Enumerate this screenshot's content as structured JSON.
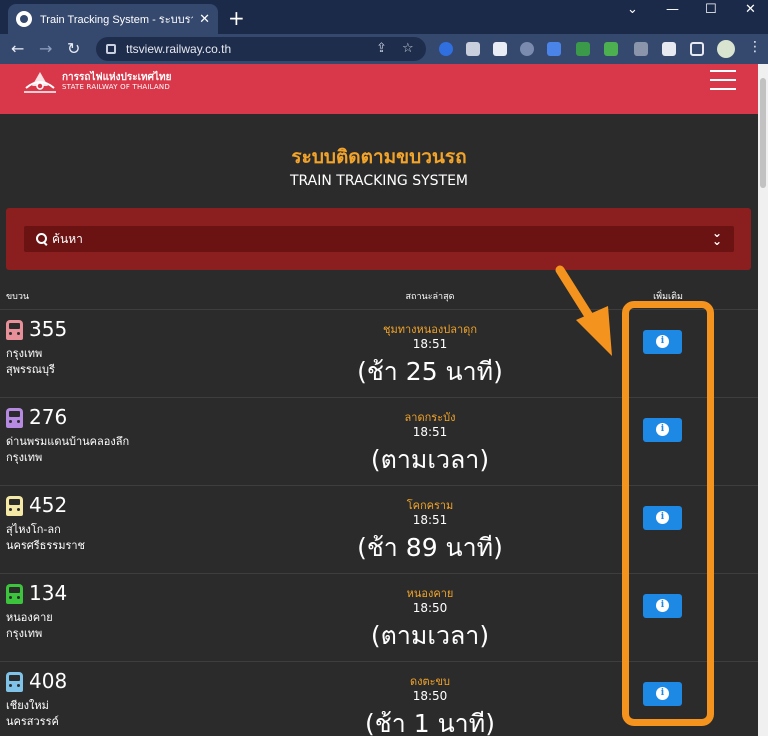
{
  "browser": {
    "tab_title": "Train Tracking System - ระบบรายงาน",
    "tab_close": "✕",
    "new_tab": "+",
    "url": "ttsview.railway.co.th",
    "window_controls": [
      "⌄",
      "—",
      "☐",
      "✕"
    ]
  },
  "site": {
    "logo_th": "การรถไฟแห่งประเทศไทย",
    "logo_en": "STATE RAILWAY OF THAILAND"
  },
  "page": {
    "title_th": "ระบบติดตามขบวนรถ",
    "title_en": "TRAIN TRACKING SYSTEM"
  },
  "search": {
    "label": "ค้นหา",
    "expand_icon": "»"
  },
  "table": {
    "headers": {
      "train": "ขบวน",
      "status": "สถานะล่าสุด",
      "more": "เพิ่มเติม"
    },
    "rows": [
      {
        "number": "355",
        "origin": "กรุงเทพ",
        "destination": "สุพรรณบุรี",
        "station": "ชุมทางหนองปลาดุก",
        "time": "18:51",
        "delay": "(ช้า 25 นาที)",
        "icon_color": "#e8909a"
      },
      {
        "number": "276",
        "origin": "ด่านพรมแดนบ้านคลองลึก",
        "destination": "กรุงเทพ",
        "station": "ลาดกระบัง",
        "time": "18:51",
        "delay": "(ตามเวลา)",
        "icon_color": "#b58ae0"
      },
      {
        "number": "452",
        "origin": "สุไหงโก-ลก",
        "destination": "นครศรีธรรมราช",
        "station": "โคกคราม",
        "time": "18:51",
        "delay": "(ช้า 89 นาที)",
        "icon_color": "#f3e8a5"
      },
      {
        "number": "134",
        "origin": "หนองคาย",
        "destination": "กรุงเทพ",
        "station": "หนองคาย",
        "time": "18:50",
        "delay": "(ตามเวลา)",
        "icon_color": "#3cc43c"
      },
      {
        "number": "408",
        "origin": "เชียงใหม่",
        "destination": "นครสวรรค์",
        "station": "ดงตะขบ",
        "time": "18:50",
        "delay": "(ช้า 1 นาที)",
        "icon_color": "#7fc4e8"
      }
    ]
  },
  "colors": {
    "header": "#d9384a",
    "accent": "#f2a42a",
    "info_button": "#1e88e5",
    "highlight": "#f4931e"
  }
}
